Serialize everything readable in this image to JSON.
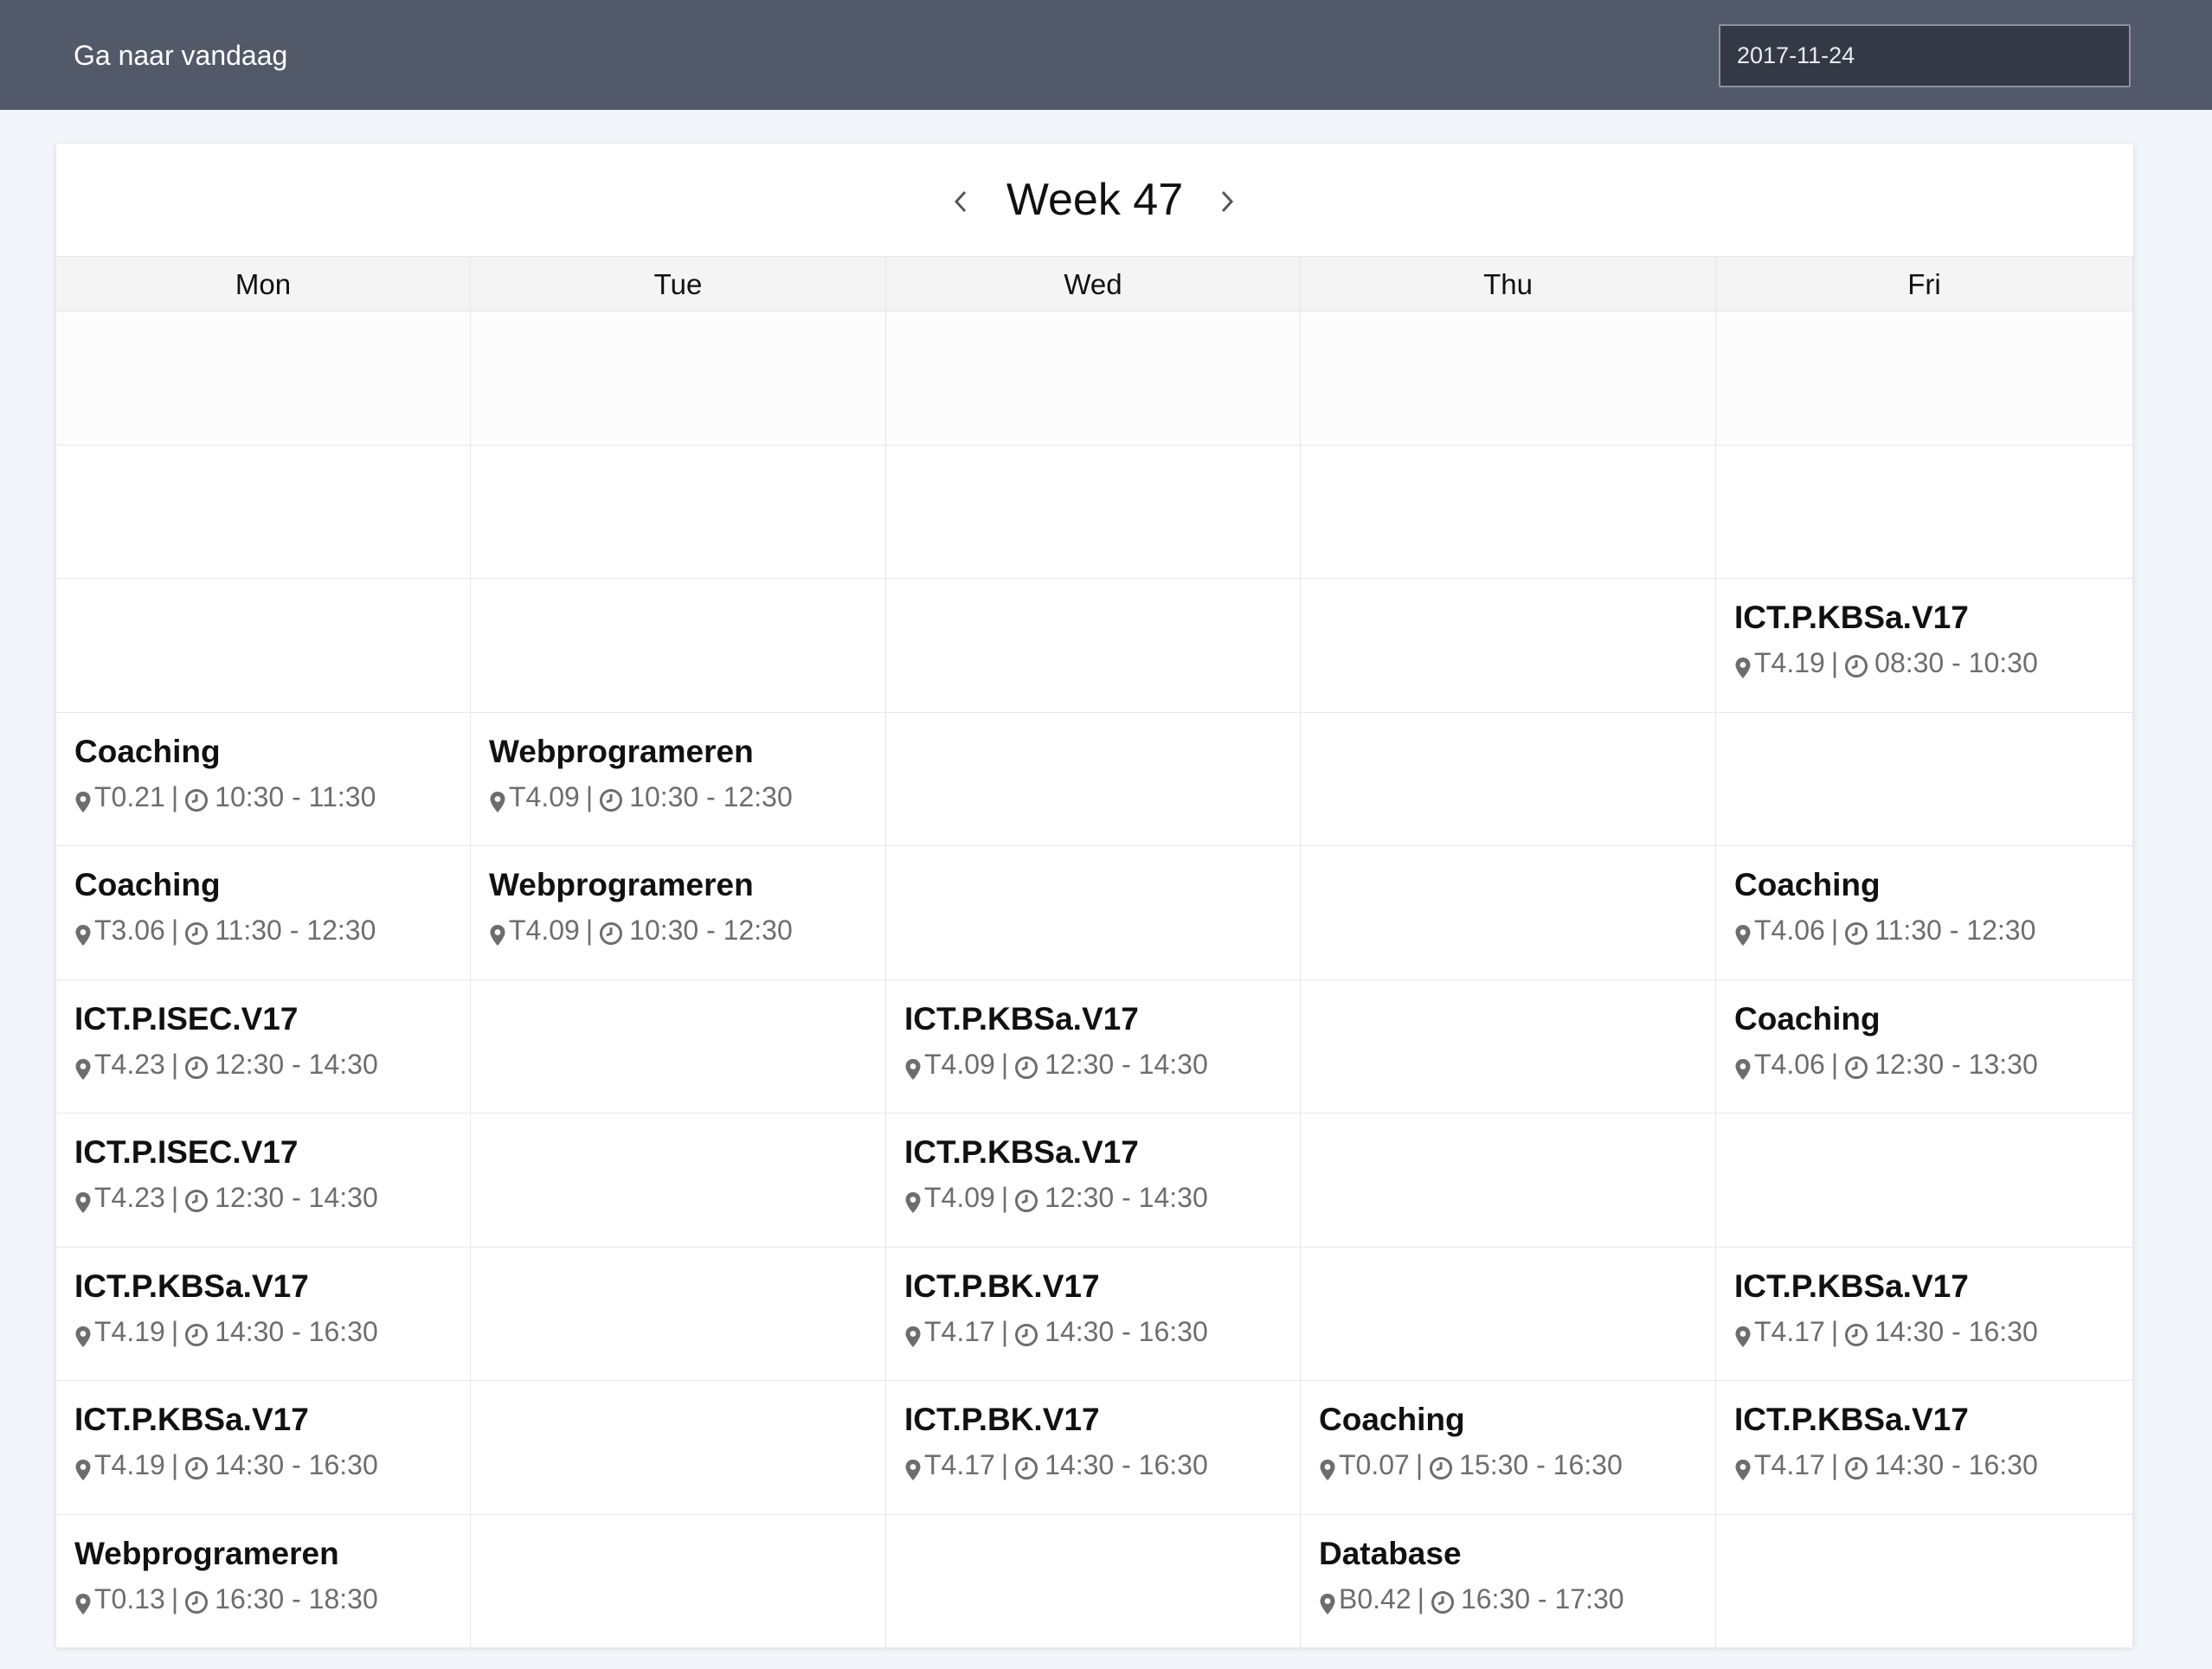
{
  "topbar": {
    "today_label": "Ga naar vandaag",
    "date_value": "2017-11-24"
  },
  "week": {
    "prev_icon": "chevron-left-icon",
    "next_icon": "chevron-right-icon",
    "title": "Week 47"
  },
  "days": [
    "Mon",
    "Tue",
    "Wed",
    "Thu",
    "Fri"
  ],
  "rows": [
    [
      null,
      null,
      null,
      null,
      null
    ],
    [
      null,
      null,
      null,
      null,
      null
    ],
    [
      null,
      null,
      null,
      null,
      {
        "title": "ICT.P.KBSa.V17",
        "room": "T4.19",
        "time": "08:30 - 10:30"
      }
    ],
    [
      {
        "title": "Coaching",
        "room": "T0.21",
        "time": "10:30 - 11:30"
      },
      {
        "title": "Webprogrameren",
        "room": "T4.09",
        "time": "10:30 - 12:30"
      },
      null,
      null,
      null
    ],
    [
      {
        "title": "Coaching",
        "room": "T3.06",
        "time": "11:30 - 12:30"
      },
      {
        "title": "Webprogrameren",
        "room": "T4.09",
        "time": "10:30 - 12:30"
      },
      null,
      null,
      {
        "title": "Coaching",
        "room": "T4.06",
        "time": "11:30 - 12:30"
      }
    ],
    [
      {
        "title": "ICT.P.ISEC.V17",
        "room": "T4.23",
        "time": "12:30 - 14:30"
      },
      null,
      {
        "title": "ICT.P.KBSa.V17",
        "room": "T4.09",
        "time": "12:30 - 14:30"
      },
      null,
      {
        "title": "Coaching",
        "room": "T4.06",
        "time": "12:30 - 13:30"
      }
    ],
    [
      {
        "title": "ICT.P.ISEC.V17",
        "room": "T4.23",
        "time": "12:30 - 14:30"
      },
      null,
      {
        "title": "ICT.P.KBSa.V17",
        "room": "T4.09",
        "time": "12:30 - 14:30"
      },
      null,
      null
    ],
    [
      {
        "title": "ICT.P.KBSa.V17",
        "room": "T4.19",
        "time": "14:30 - 16:30"
      },
      null,
      {
        "title": "ICT.P.BK.V17",
        "room": "T4.17",
        "time": "14:30 - 16:30"
      },
      null,
      {
        "title": "ICT.P.KBSa.V17",
        "room": "T4.17",
        "time": "14:30 - 16:30"
      }
    ],
    [
      {
        "title": "ICT.P.KBSa.V17",
        "room": "T4.19",
        "time": "14:30 - 16:30"
      },
      null,
      {
        "title": "ICT.P.BK.V17",
        "room": "T4.17",
        "time": "14:30 - 16:30"
      },
      {
        "title": "Coaching",
        "room": "T0.07",
        "time": "15:30 - 16:30"
      },
      {
        "title": "ICT.P.KBSa.V17",
        "room": "T4.17",
        "time": "14:30 - 16:30"
      }
    ],
    [
      {
        "title": "Webprogrameren",
        "room": "T0.13",
        "time": "16:30 - 18:30"
      },
      null,
      null,
      {
        "title": "Database",
        "room": "B0.42",
        "time": "16:30 - 17:30"
      },
      null
    ]
  ],
  "separator": "|",
  "icons": {
    "location": "map-marker-icon",
    "time": "clock-icon"
  },
  "colors": {
    "topbar": "#525a69",
    "date_input_bg": "#343a45",
    "page_bg": "#f2f5f9",
    "meta_text": "#6d6d6d"
  }
}
